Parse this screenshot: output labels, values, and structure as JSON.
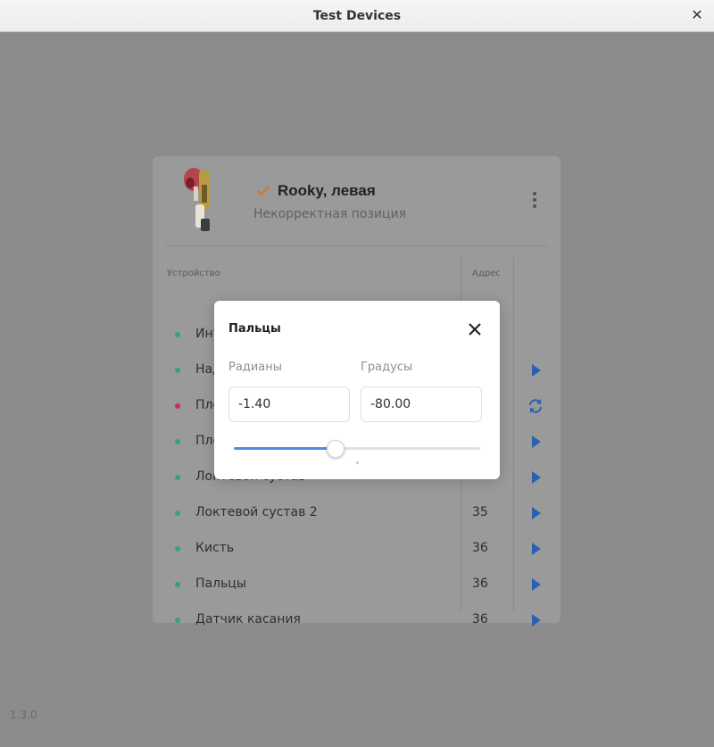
{
  "window": {
    "title": "Test Devices"
  },
  "app": {
    "version": "1.3.0"
  },
  "device": {
    "name": "Rooky, левая",
    "status": "Некорректная позиция"
  },
  "table": {
    "columns": {
      "device": "Устройство",
      "address": "Адрес"
    },
    "rows": [
      {
        "label": "Интерфейсная плата",
        "address": "",
        "status_color": "#37a36b",
        "action": ""
      },
      {
        "label": "Надплечье",
        "address": "",
        "status_color": "#37a36b",
        "action": "play-icon"
      },
      {
        "label": "Плечо",
        "address": "",
        "status_color": "#c2305a",
        "action": "refresh-icon"
      },
      {
        "label": "Плечо 2",
        "address": "",
        "status_color": "#37a36b",
        "action": "play-icon"
      },
      {
        "label": "Локтевой сустав",
        "address": "",
        "status_color": "#37a36b",
        "action": "play-icon"
      },
      {
        "label": "Локтевой сустав 2",
        "address": "35",
        "status_color": "#37a36b",
        "action": "play-icon"
      },
      {
        "label": "Кисть",
        "address": "36",
        "status_color": "#37a36b",
        "action": "play-icon"
      },
      {
        "label": "Пальцы",
        "address": "36",
        "status_color": "#37a36b",
        "action": "play-icon"
      },
      {
        "label": "Датчик касания",
        "address": "36",
        "status_color": "#37a36b",
        "action": "play-icon"
      }
    ]
  },
  "modal": {
    "title": "Пальцы",
    "radians_label": "Радианы",
    "degrees_label": "Градусы",
    "radians_value": "-1.40",
    "degrees_value": "-80.00",
    "slider_fraction": 0.41,
    "slider_tick_fraction": 0.5
  },
  "colors": {
    "accent": "#4a90e2",
    "action_icon": "#2c5fb0",
    "check": "#d9741a"
  }
}
